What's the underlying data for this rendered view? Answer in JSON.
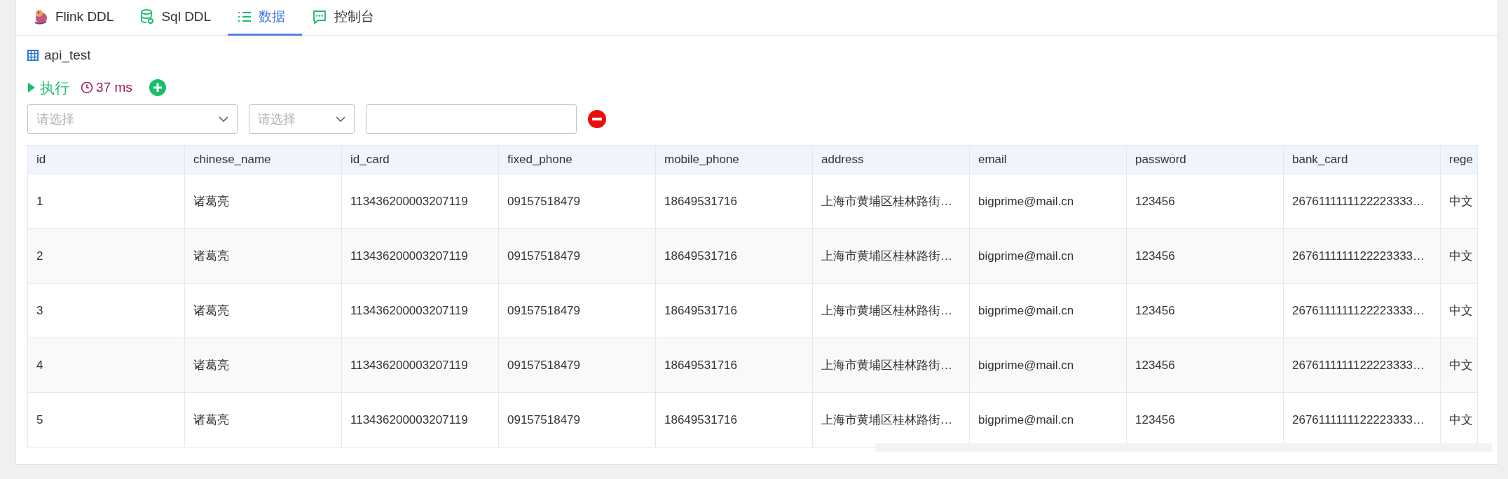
{
  "tabs": [
    {
      "label": "Flink DDL",
      "selected": false
    },
    {
      "label": "Sql DDL",
      "selected": false
    },
    {
      "label": "数据",
      "selected": true
    },
    {
      "label": "控制台",
      "selected": false
    }
  ],
  "table_name": "api_test",
  "toolbar": {
    "run_label": "执行",
    "elapsed": "37 ms"
  },
  "filter": {
    "field_placeholder": "请选择",
    "operator_placeholder": "请选择"
  },
  "table": {
    "columns": [
      "id",
      "chinese_name",
      "id_card",
      "fixed_phone",
      "mobile_phone",
      "address",
      "email",
      "password",
      "bank_card",
      "rege"
    ],
    "rows": [
      [
        "1",
        "诸葛亮",
        "113436200003207119",
        "09157518479",
        "18649531716",
        "上海市黄埔区桂林路街…",
        "bigprime@mail.cn",
        "123456",
        "2676111111122223333…",
        "中文"
      ],
      [
        "2",
        "诸葛亮",
        "113436200003207119",
        "09157518479",
        "18649531716",
        "上海市黄埔区桂林路街…",
        "bigprime@mail.cn",
        "123456",
        "2676111111122223333…",
        "中文"
      ],
      [
        "3",
        "诸葛亮",
        "113436200003207119",
        "09157518479",
        "18649531716",
        "上海市黄埔区桂林路街…",
        "bigprime@mail.cn",
        "123456",
        "2676111111122223333…",
        "中文"
      ],
      [
        "4",
        "诸葛亮",
        "113436200003207119",
        "09157518479",
        "18649531716",
        "上海市黄埔区桂林路街…",
        "bigprime@mail.cn",
        "123456",
        "2676111111122223333…",
        "中文"
      ],
      [
        "5",
        "诸葛亮",
        "113436200003207119",
        "09157518479",
        "18649531716",
        "上海市黄埔区桂林路街…",
        "bigprime@mail.cn",
        "123456",
        "2676111111122223333…",
        "中文"
      ]
    ]
  }
}
